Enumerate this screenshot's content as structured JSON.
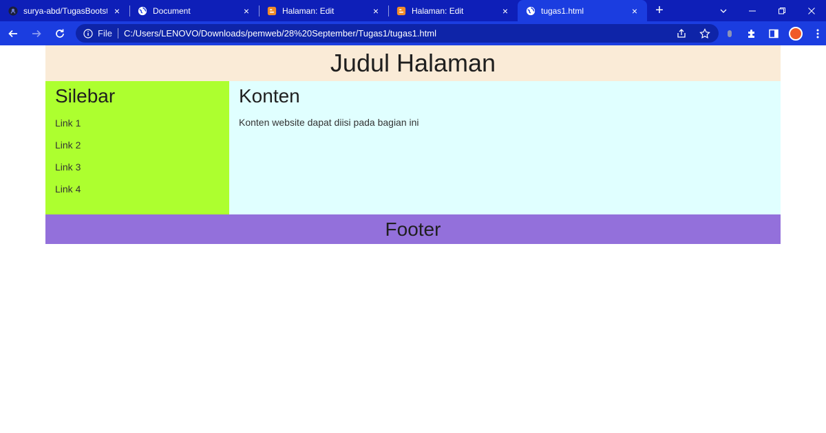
{
  "browser": {
    "tabs": [
      {
        "title": "surya-abd/TugasBootstrap",
        "icon": "github-icon",
        "active": false
      },
      {
        "title": "Document",
        "icon": "globe-icon",
        "active": false
      },
      {
        "title": "Halaman: Edit",
        "icon": "blogger-icon",
        "active": false
      },
      {
        "title": "Halaman: Edit",
        "icon": "blogger-icon",
        "active": false
      },
      {
        "title": "tugas1.html",
        "icon": "globe-icon",
        "active": true
      }
    ],
    "close_glyph": "×",
    "new_tab_glyph": "+",
    "address": {
      "scheme_label": "File",
      "url": "C:/Users/LENOVO/Downloads/pemweb/28%20September/Tugas1/tugas1.html"
    }
  },
  "page": {
    "header_title": "Judul Halaman",
    "sidebar": {
      "title": "Silebar",
      "links": [
        "Link 1",
        "Link 2",
        "Link 3",
        "Link 4"
      ]
    },
    "content": {
      "title": "Konten",
      "text": "Konten website dapat diisi pada bagian ini"
    },
    "footer_title": "Footer",
    "colors": {
      "header": "#faebd7",
      "sidebar": "#adff2f",
      "content": "#e0ffff",
      "footer": "#9370db",
      "chrome": "#1b3de0"
    }
  }
}
